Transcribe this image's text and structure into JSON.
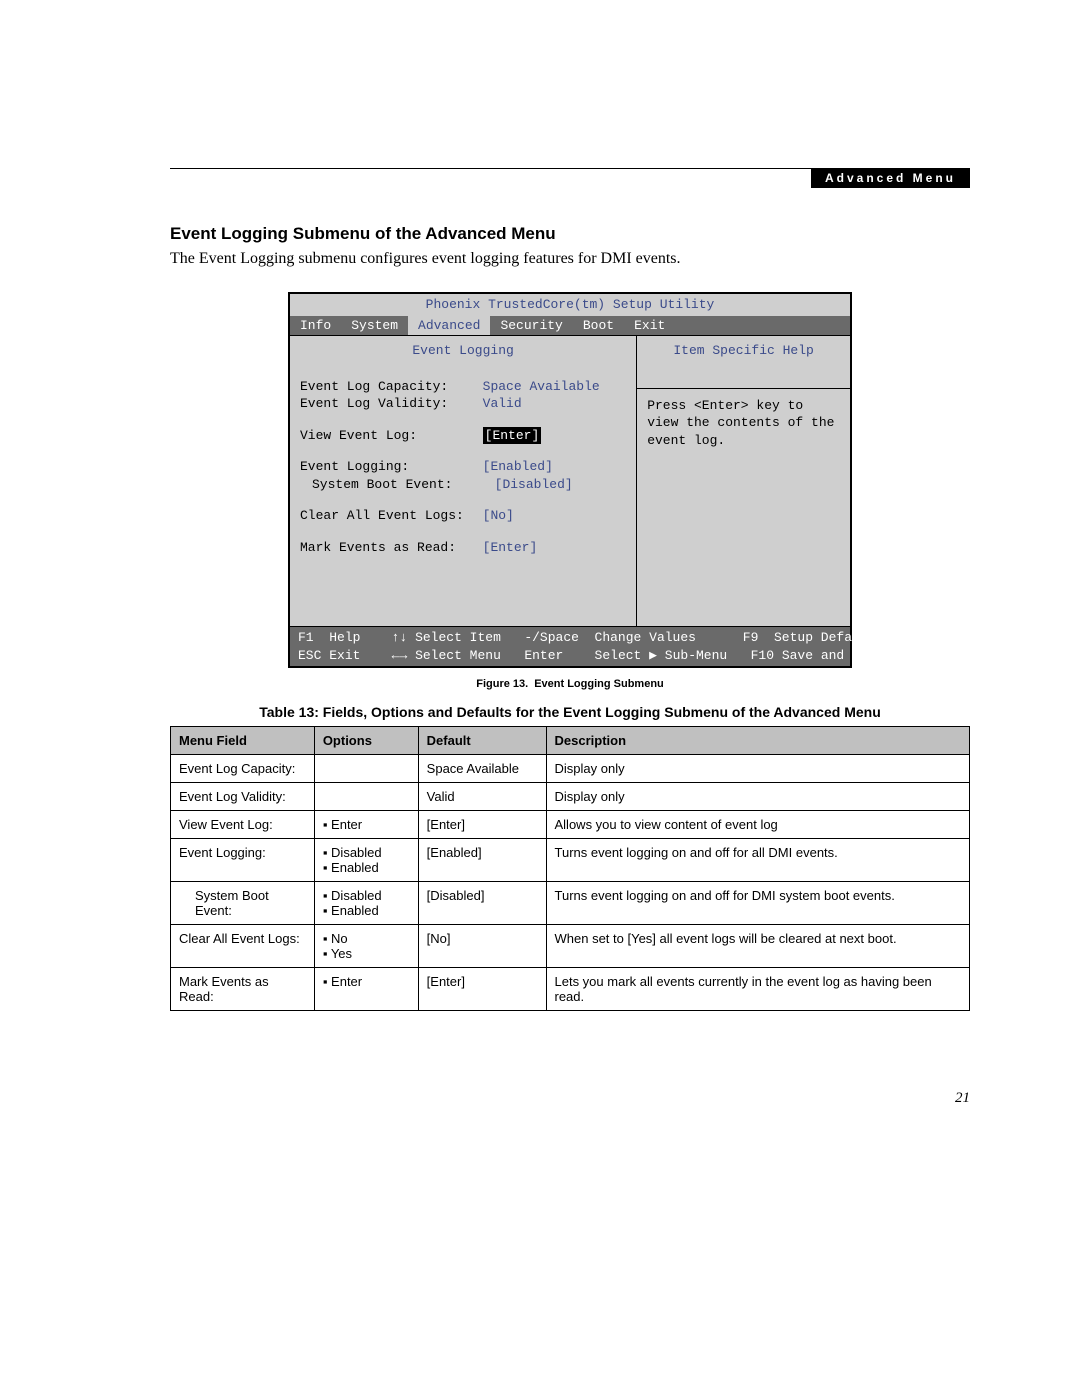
{
  "header": {
    "tab": "Advanced Menu"
  },
  "section": {
    "title": "Event Logging Submenu of the Advanced Menu",
    "intro": "The Event Logging submenu configures event logging features for DMI events."
  },
  "bios": {
    "app_title": "Phoenix TrustedCore(tm) Setup Utility",
    "menu": [
      "Info",
      "System",
      "Advanced",
      "Security",
      "Boot",
      "Exit"
    ],
    "active_menu": "Advanced",
    "left_title": "Event Logging",
    "right_title": "Item Specific Help",
    "help_text": "Press <Enter> key to view the contents of the event log.",
    "fields": {
      "capacity": {
        "label": "Event Log Capacity:",
        "value": "Space Available"
      },
      "validity": {
        "label": "Event Log Validity:",
        "value": "Valid"
      },
      "view": {
        "label": "View Event Log:",
        "value": "[Enter]"
      },
      "logging": {
        "label": "Event Logging:",
        "value": "[Enabled]"
      },
      "bootevt": {
        "label": "System Boot Event:",
        "value": "[Disabled]"
      },
      "clear": {
        "label": "Clear All Event Logs:",
        "value": "[No]"
      },
      "mark": {
        "label": "Mark Events as Read:",
        "value": "[Enter]"
      }
    },
    "footer": {
      "l1a": "F1",
      "l1b": "Help",
      "l1c": "↑↓",
      "l1d": "Select Item",
      "l1e": "-/Space",
      "l1f": "Change Values",
      "l1g": "F9",
      "l1h": "Setup Defaults",
      "l2a": "ESC",
      "l2b": "Exit",
      "l2c": "←→",
      "l2d": "Select Menu",
      "l2e": "Enter",
      "l2f": "Select ▶ Sub-Menu",
      "l2g": "F10",
      "l2h": "Save and Exit"
    }
  },
  "figure": {
    "num": "Figure 13.",
    "caption": "Event Logging Submenu"
  },
  "table": {
    "title": "Table 13: Fields, Options and Defaults for the Event Logging Submenu of the Advanced Menu",
    "headers": [
      "Menu Field",
      "Options",
      "Default",
      "Description"
    ],
    "rows": [
      {
        "field": "Event Log Capacity:",
        "options": [],
        "default": "Space Available",
        "desc": "Display only",
        "indent": false
      },
      {
        "field": "Event Log Validity:",
        "options": [],
        "default": "Valid",
        "desc": "Display only",
        "indent": false
      },
      {
        "field": "View Event Log:",
        "options": [
          "Enter"
        ],
        "default": "[Enter]",
        "desc": "Allows you to view content of event log",
        "indent": false
      },
      {
        "field": "Event Logging:",
        "options": [
          "Disabled",
          "Enabled"
        ],
        "default": "[Enabled]",
        "desc": "Turns event logging on and off for all DMI events.",
        "indent": false
      },
      {
        "field": "System Boot Event:",
        "options": [
          "Disabled",
          "Enabled"
        ],
        "default": "[Disabled]",
        "desc": "Turns event logging on and off for DMI system boot events.",
        "indent": true
      },
      {
        "field": "Clear All Event Logs:",
        "options": [
          "No",
          "Yes"
        ],
        "default": "[No]",
        "desc": "When set to [Yes] all event logs will be cleared at next boot.",
        "indent": false
      },
      {
        "field": "Mark Events as Read:",
        "options": [
          "Enter"
        ],
        "default": "[Enter]",
        "desc": "Lets you mark all events currently in the event log as having been read.",
        "indent": false
      }
    ]
  },
  "page_number": "21"
}
